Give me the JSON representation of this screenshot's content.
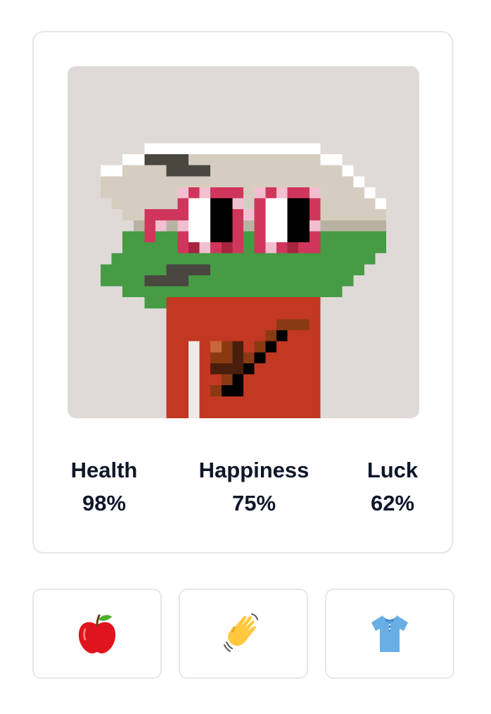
{
  "avatar": {
    "background_color": "#dfdad8",
    "skin_color": "#469b44",
    "hat_color": "#d5cec0",
    "shirt_color": "#c23822",
    "eye_frame_color": "#d0365c"
  },
  "stats": [
    {
      "label": "Health",
      "value": "98%"
    },
    {
      "label": "Happiness",
      "value": "75%"
    },
    {
      "label": "Luck",
      "value": "62%"
    }
  ],
  "actions": [
    {
      "icon": "apple-icon",
      "emoji": "🍎"
    },
    {
      "icon": "waving-hand-icon",
      "emoji": "👋"
    },
    {
      "icon": "shirt-icon",
      "emoji": "👕"
    }
  ]
}
